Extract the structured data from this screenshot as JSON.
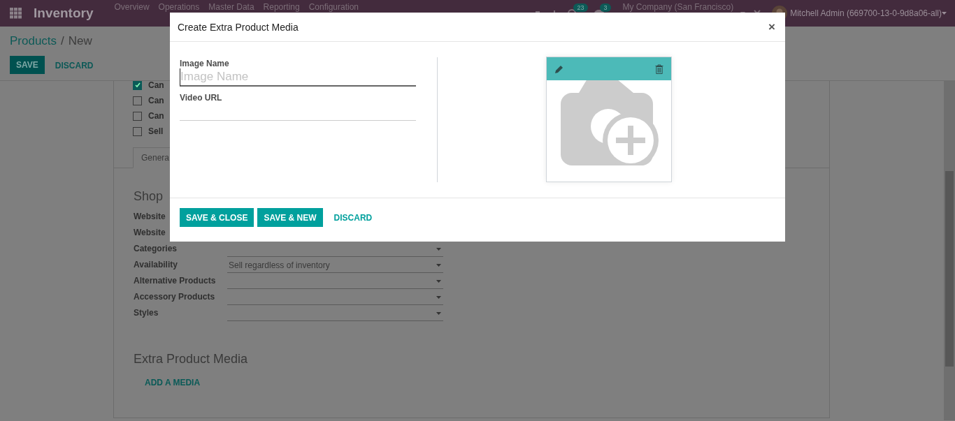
{
  "navbar": {
    "app_title": "Inventory",
    "menu": [
      "Overview",
      "Operations",
      "Master Data",
      "Reporting",
      "Configuration"
    ],
    "activity_badge": "23",
    "message_badge": "3",
    "company": "My Company (San Francisco)",
    "user": "Mitchell Admin (669700-13-0-9d8a06-all)"
  },
  "breadcrumb": {
    "parent": "Products",
    "separator": "/",
    "current": "New"
  },
  "control_buttons": [
    {
      "label": "SAVE",
      "kind": "primary"
    },
    {
      "label": "DISCARD",
      "kind": "link"
    }
  ],
  "options": [
    {
      "label": "Can",
      "checked": true
    },
    {
      "label": "Can",
      "checked": false
    },
    {
      "label": "Can",
      "checked": false
    },
    {
      "label": "Sell",
      "checked": false
    }
  ],
  "tabs": [
    {
      "label": "Genera",
      "selected": true
    }
  ],
  "shop": {
    "title": "Shop",
    "fields": [
      {
        "label": "Website",
        "kind": "label"
      },
      {
        "label": "Website",
        "kind": "label"
      },
      {
        "label": "Categories",
        "kind": "dropdown"
      },
      {
        "label": "Availability",
        "kind": "dropdown",
        "value": "Sell regardless of inventory"
      },
      {
        "label": "Alternative Products",
        "kind": "dropdown"
      },
      {
        "label": "Accessory Products",
        "kind": "dropdown"
      },
      {
        "label": "Styles",
        "kind": "dropdown"
      }
    ]
  },
  "media": {
    "title": "Extra Product Media",
    "add_link": "ADD A MEDIA"
  },
  "dialog": {
    "title": "Create Extra Product Media",
    "close": "×",
    "fields": [
      {
        "label": "Image Name",
        "placeholder": "Image Name",
        "focused": true
      },
      {
        "label": "Video URL",
        "focused": false
      }
    ],
    "buttons": [
      {
        "label": "SAVE & CLOSE",
        "kind": "primary"
      },
      {
        "label": "SAVE & NEW",
        "kind": "primary"
      },
      {
        "label": "DISCARD",
        "kind": "link"
      }
    ]
  }
}
